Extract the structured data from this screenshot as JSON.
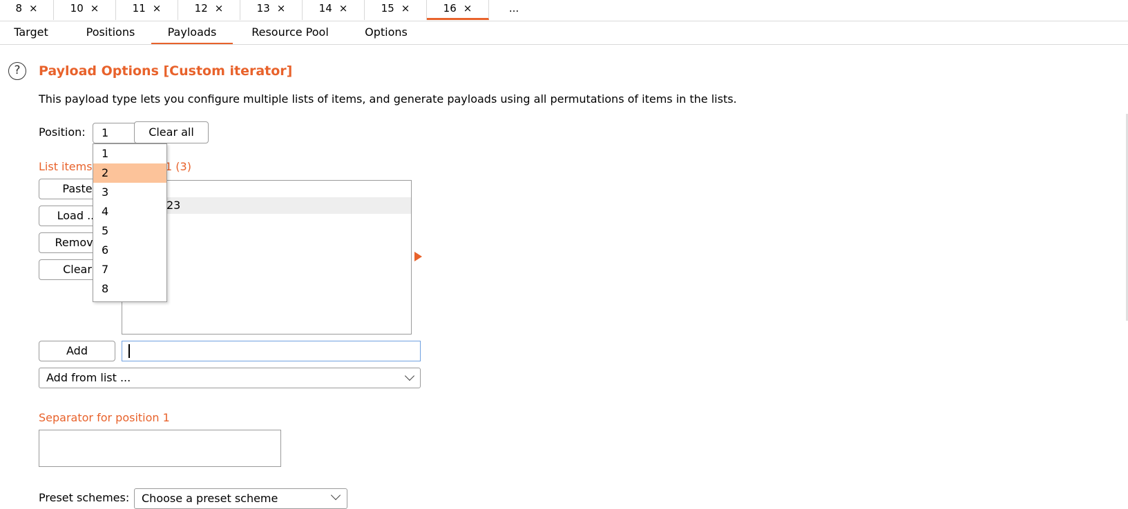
{
  "attack_tabs": [
    {
      "label": "8",
      "close": "×"
    },
    {
      "label": "10",
      "close": "×"
    },
    {
      "label": "11",
      "close": "×"
    },
    {
      "label": "12",
      "close": "×"
    },
    {
      "label": "13",
      "close": "×"
    },
    {
      "label": "14",
      "close": "×"
    },
    {
      "label": "15",
      "close": "×"
    },
    {
      "label": "16",
      "close": "×",
      "active": true
    },
    {
      "label": "..."
    }
  ],
  "sub_tabs": [
    "Target",
    "Positions",
    "Payloads",
    "Resource Pool",
    "Options"
  ],
  "active_sub_tab": "Payloads",
  "section": {
    "help_glyph": "?",
    "title": "Payload Options [Custom iterator]",
    "description": "This payload type lets you configure multiple lists of items, and generate payloads using all permutations of items in the lists."
  },
  "position": {
    "label": "Position:",
    "value": "1",
    "clear_all_label": "Clear all"
  },
  "list_items_label_visible": "List items",
  "list_items_label_tail": "1 (3)",
  "list_buttons": {
    "paste": "Paste",
    "load": "Load ...",
    "remove": "Remove",
    "clear": "Clear"
  },
  "list_values": [
    "",
    "23"
  ],
  "add": {
    "button": "Add",
    "input_value": ""
  },
  "add_from_list": "Add from list ...",
  "separator_label": "Separator for position 1",
  "separator_value": "",
  "preset": {
    "label": "Preset schemes:",
    "placeholder": "Choose a preset scheme"
  },
  "position_dropdown": {
    "options": [
      "1",
      "2",
      "3",
      "4",
      "5",
      "6",
      "7",
      "8"
    ],
    "highlighted": "2"
  },
  "colors": {
    "accent": "#e8622b",
    "highlight": "#fcc39a",
    "input_focus": "#6fa0e0"
  }
}
